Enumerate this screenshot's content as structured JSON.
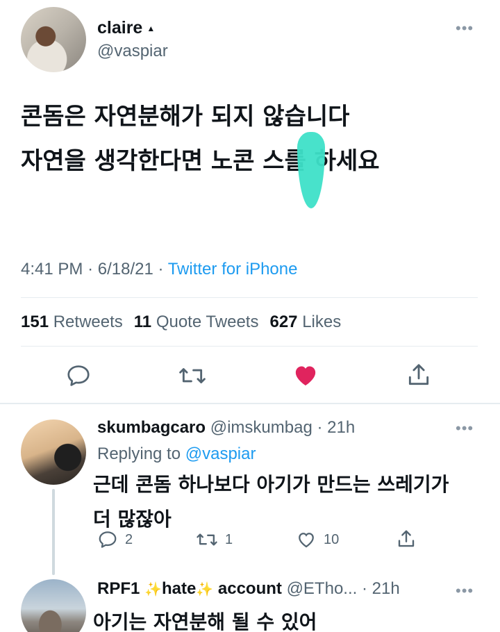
{
  "main_tweet": {
    "author_name": "claire",
    "author_handle": "@vaspiar",
    "text_line1": "콘돔은 자연분해가 되지 않습니다",
    "text_line2": "자연을 생각한다면 노콘 스를 하세요",
    "time": "4:41 PM",
    "date": "6/18/21",
    "client": "Twitter for iPhone",
    "retweets_count": "151",
    "retweets_label": "Retweets",
    "quotes_count": "11",
    "quotes_label": "Quote Tweets",
    "likes_count": "627",
    "likes_label": "Likes",
    "like_color": "#e0245e"
  },
  "reply1": {
    "author_name": "skumbagcaro",
    "author_handle": "@imskumbag",
    "time": "21h",
    "replying_prefix": "Replying to",
    "replying_to": "@vaspiar",
    "text_line1": "근데 콘돔 하나보다 아기가 만드는 쓰레기가",
    "text_line2": "더 많잖아",
    "reply_count": "2",
    "retweet_count": "1",
    "like_count": "10"
  },
  "reply2": {
    "author_name_a": "RPF1",
    "author_name_b": "hate",
    "author_name_c": "account",
    "sparkle": "✨",
    "author_handle": "@ETho...",
    "time": "21h",
    "text_line1": "아기는 자연분해 될 수 있어"
  },
  "colors": {
    "accent": "#1d9bf0",
    "divider": "#e6ecf0",
    "redaction": "#3ee0c8"
  }
}
